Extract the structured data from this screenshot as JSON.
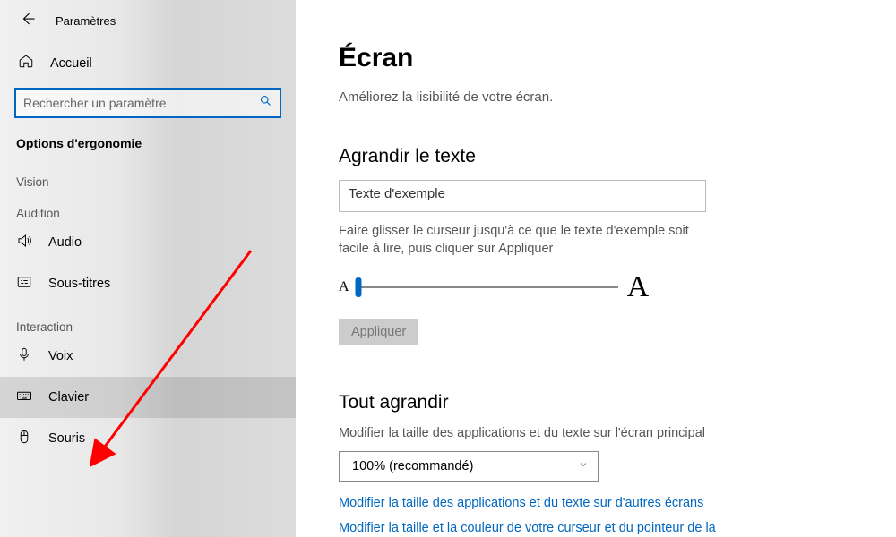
{
  "appTitle": "Paramètres",
  "home": "Accueil",
  "searchPlaceholder": "Rechercher un paramètre",
  "sectionTitle": "Options d'ergonomie",
  "groups": {
    "vision": "Vision",
    "audition": "Audition",
    "interaction": "Interaction"
  },
  "nav": {
    "audio": "Audio",
    "subtitles": "Sous-titres",
    "voice": "Voix",
    "keyboard": "Clavier",
    "mouse": "Souris"
  },
  "page": {
    "title": "Écran",
    "subtitle": "Améliorez la lisibilité de votre écran.",
    "enlargeTextTitle": "Agrandir le texte",
    "sampleLabel": "Texte d'exemple",
    "sliderDesc": "Faire glisser le curseur jusqu'à ce que le texte d'exemple soit facile à lire, puis cliquer sur Appliquer",
    "applyLabel": "Appliquer",
    "enlargeAllTitle": "Tout agrandir",
    "enlargeAllDesc": "Modifier la taille des applications et du texte sur l'écran principal",
    "scaleSelected": "100% (recommandé)",
    "link1": "Modifier la taille des applications et du texte sur d'autres écrans",
    "link2": "Modifier la taille et la couleur de votre curseur et du pointeur de la"
  }
}
